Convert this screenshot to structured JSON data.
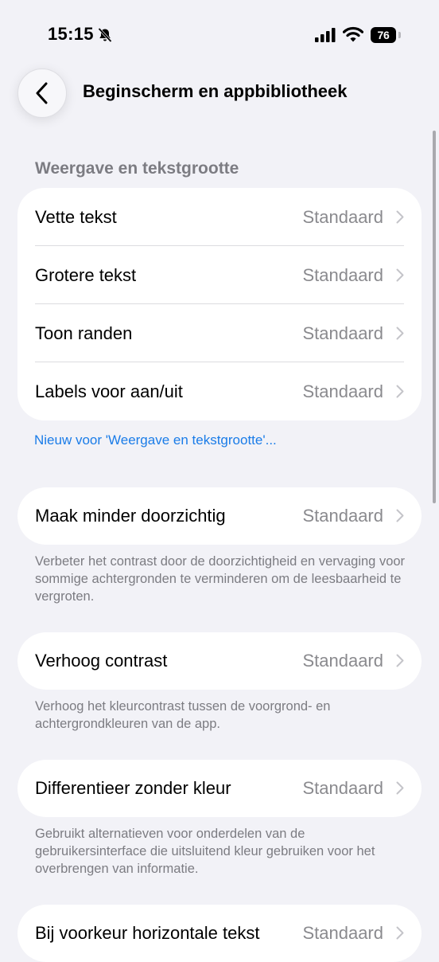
{
  "status_bar": {
    "time": "15:15",
    "battery": "76",
    "icons": [
      "bell-slash-icon",
      "signal-icon",
      "wifi-icon",
      "battery-icon"
    ]
  },
  "nav": {
    "title": "Beginscherm en appbibliotheek",
    "back_icon": "chevron-left-icon"
  },
  "sections": {
    "display": {
      "header": "Weergave en tekstgrootte",
      "rows": [
        {
          "label": "Vette tekst",
          "value": "Standaard"
        },
        {
          "label": "Grotere tekst",
          "value": "Standaard"
        },
        {
          "label": "Toon randen",
          "value": "Standaard"
        },
        {
          "label": "Labels voor aan/uit",
          "value": "Standaard"
        }
      ],
      "link": "Nieuw voor 'Weergave en tekstgrootte'..."
    },
    "transparency": {
      "label": "Maak minder doorzichtig",
      "value": "Standaard",
      "footer": "Verbeter het contrast door de doorzichtigheid en vervaging voor sommige achtergronden te verminderen om de leesbaarheid te vergroten."
    },
    "contrast": {
      "label": "Verhoog contrast",
      "value": "Standaard",
      "footer": "Verhoog het kleurcontrast tussen de voorgrond- en achtergrondkleuren van de app."
    },
    "differentiate": {
      "label": "Differentieer zonder kleur",
      "value": "Standaard",
      "footer": "Gebruikt alternatieven voor onderdelen van de gebruikersinterface die uitsluitend kleur gebruiken voor het overbrengen van informatie."
    },
    "horizontal": {
      "label": "Bij voorkeur horizontale tekst",
      "value": "Standaard"
    }
  },
  "colors": {
    "background": "#f2f2f7",
    "card": "#ffffff",
    "secondary_text": "#8a8a8e",
    "link": "#1a7ce8"
  }
}
